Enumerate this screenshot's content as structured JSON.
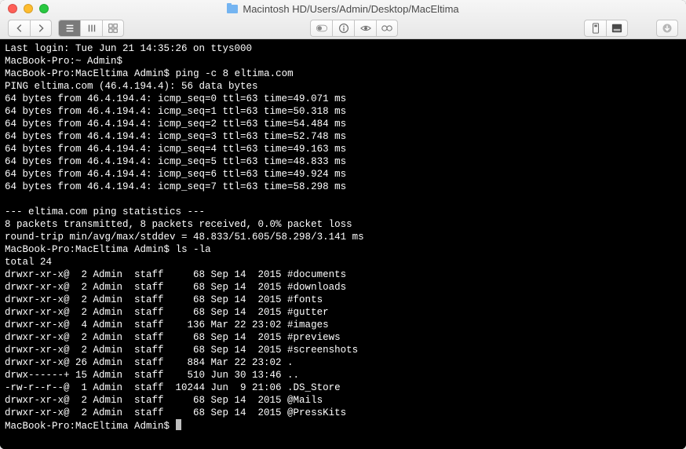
{
  "window": {
    "title_prefix_icon": "folder",
    "title": "Macintosh HD/Users/Admin/Desktop/MacEltima"
  },
  "terminal": {
    "last_login": "Last login: Tue Jun 21 14:35:26 on ttys000",
    "prompt_home": "MacBook-Pro:~ Admin$",
    "prompt_dir": "MacBook-Pro:MacEltima Admin$",
    "cmd_ping": "ping -c 8 eltima.com",
    "ping_header": "PING eltima.com (46.4.194.4): 56 data bytes",
    "ping_lines": [
      "64 bytes from 46.4.194.4: icmp_seq=0 ttl=63 time=49.071 ms",
      "64 bytes from 46.4.194.4: icmp_seq=1 ttl=63 time=50.318 ms",
      "64 bytes from 46.4.194.4: icmp_seq=2 ttl=63 time=54.484 ms",
      "64 bytes from 46.4.194.4: icmp_seq=3 ttl=63 time=52.748 ms",
      "64 bytes from 46.4.194.4: icmp_seq=4 ttl=63 time=49.163 ms",
      "64 bytes from 46.4.194.4: icmp_seq=5 ttl=63 time=48.833 ms",
      "64 bytes from 46.4.194.4: icmp_seq=6 ttl=63 time=49.924 ms",
      "64 bytes from 46.4.194.4: icmp_seq=7 ttl=63 time=58.298 ms"
    ],
    "ping_stats_header": "--- eltima.com ping statistics ---",
    "ping_stats_1": "8 packets transmitted, 8 packets received, 0.0% packet loss",
    "ping_stats_2": "round-trip min/avg/max/stddev = 48.833/51.605/58.298/3.141 ms",
    "cmd_ls": "ls -la",
    "ls_total": "total 24",
    "ls_rows": [
      "drwxr-xr-x@  2 Admin  staff     68 Sep 14  2015 #documents",
      "drwxr-xr-x@  2 Admin  staff     68 Sep 14  2015 #downloads",
      "drwxr-xr-x@  2 Admin  staff     68 Sep 14  2015 #fonts",
      "drwxr-xr-x@  2 Admin  staff     68 Sep 14  2015 #gutter",
      "drwxr-xr-x@  4 Admin  staff    136 Mar 22 23:02 #images",
      "drwxr-xr-x@  2 Admin  staff     68 Sep 14  2015 #previews",
      "drwxr-xr-x@  2 Admin  staff     68 Sep 14  2015 #screenshots",
      "drwxr-xr-x@ 26 Admin  staff    884 Mar 22 23:02 .",
      "drwx------+ 15 Admin  staff    510 Jun 30 13:46 ..",
      "-rw-r--r--@  1 Admin  staff  10244 Jun  9 21:06 .DS_Store",
      "drwxr-xr-x@  2 Admin  staff     68 Sep 14  2015 @Mails",
      "drwxr-xr-x@  2 Admin  staff     68 Sep 14  2015 @PressKits"
    ]
  }
}
